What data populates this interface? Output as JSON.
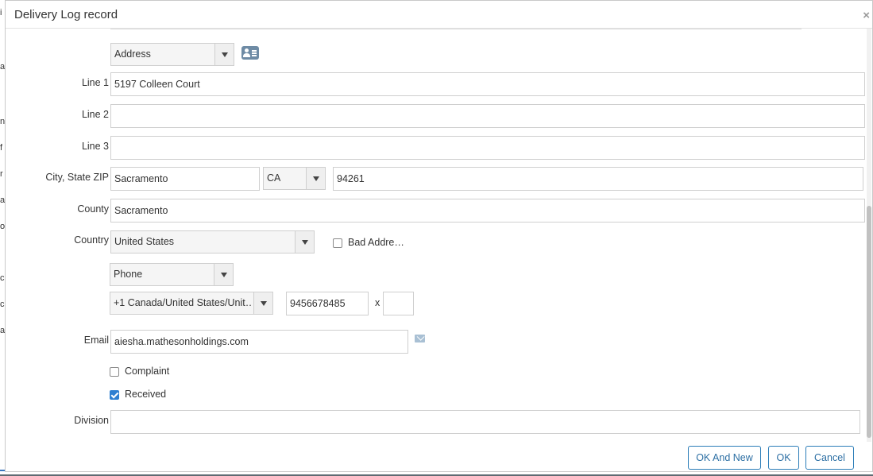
{
  "background_fragments": [
    "i",
    "a",
    "n",
    "f",
    "r",
    "a",
    "o",
    "c",
    "c",
    "a"
  ],
  "dialog": {
    "title": "Delivery Log record",
    "close_label": "×"
  },
  "address": {
    "type_selected": "Address",
    "line1_label": "Line 1",
    "line1_value": "5197 Colleen Court",
    "line2_label": "Line 2",
    "line2_value": "",
    "line3_label": "Line 3",
    "line3_value": "",
    "city_state_zip_label": "City, State ZIP",
    "city_value": "Sacramento",
    "state_value": "CA",
    "zip_value": "94261",
    "county_label": "County",
    "county_value": "Sacramento",
    "country_label": "Country",
    "country_value": "United States",
    "bad_address_label": "Bad Addre…",
    "bad_address_checked": false
  },
  "phone": {
    "type_selected": "Phone",
    "country_code_value": "+1 Canada/United States/Unit…",
    "number_value": "9456678485",
    "ext_label": "x",
    "ext_value": ""
  },
  "email": {
    "label": "Email",
    "value": "aiesha.mathesonholdings.com"
  },
  "flags": {
    "complaint_label": "Complaint",
    "complaint_checked": false,
    "received_label": "Received",
    "received_checked": true
  },
  "division": {
    "label": "Division",
    "value": ""
  },
  "buttons": {
    "ok_and_new": "OK And New",
    "ok": "OK",
    "cancel": "Cancel"
  },
  "icons": {
    "contact_card": "contact-card-icon",
    "mail": "mail-icon",
    "close": "close-icon",
    "dropdown": "chevron-down-icon"
  },
  "colors": {
    "accent": "#2b7db8",
    "checkbox_checked": "#2f7fd1"
  }
}
